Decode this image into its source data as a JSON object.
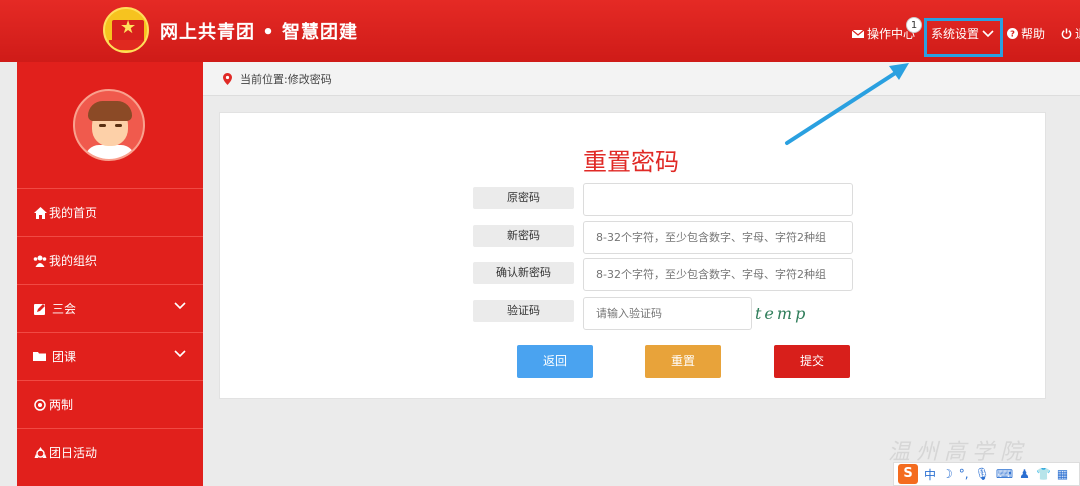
{
  "header": {
    "site_title": "网上共青团 • 智慧团建",
    "ops_center": "操作中心",
    "ops_badge": "1",
    "system_settings": "系统设置",
    "help": "帮助",
    "logout_partial": "退"
  },
  "sidebar": {
    "items": [
      {
        "label": "我的首页",
        "icon": "home-icon"
      },
      {
        "label": "我的组织",
        "icon": "users-icon"
      },
      {
        "label": "三会",
        "icon": "edit-icon"
      },
      {
        "label": "团课",
        "icon": "folder-icon"
      },
      {
        "label": "两制",
        "icon": "target-icon"
      },
      {
        "label": "团日活动",
        "icon": "recycle-icon"
      }
    ]
  },
  "breadcrumb": {
    "text": "当前位置:修改密码"
  },
  "form": {
    "title": "重置密码",
    "old_label": "原密码",
    "old_placeholder": "",
    "new_label": "新密码",
    "new_placeholder": "8-32个字符，至少包含数字、字母、字符2种组",
    "confirm_label": "确认新密码",
    "confirm_placeholder": "8-32个字符，至少包含数字、字母、字符2种组",
    "captcha_label": "验证码",
    "captcha_placeholder": "请输入验证码",
    "captcha_text": "temp",
    "back": "返回",
    "reset": "重置",
    "submit": "提交"
  },
  "watermark": "温州高学院",
  "ime": {
    "mode": "中"
  },
  "colors": {
    "header": "#d8211d",
    "sidebar": "#e1201c",
    "title": "#e02a26",
    "back_btn": "#4aa3f0",
    "reset_btn": "#e8a33a",
    "submit_btn": "#d81f1b",
    "highlight": "#2aa0e0"
  }
}
